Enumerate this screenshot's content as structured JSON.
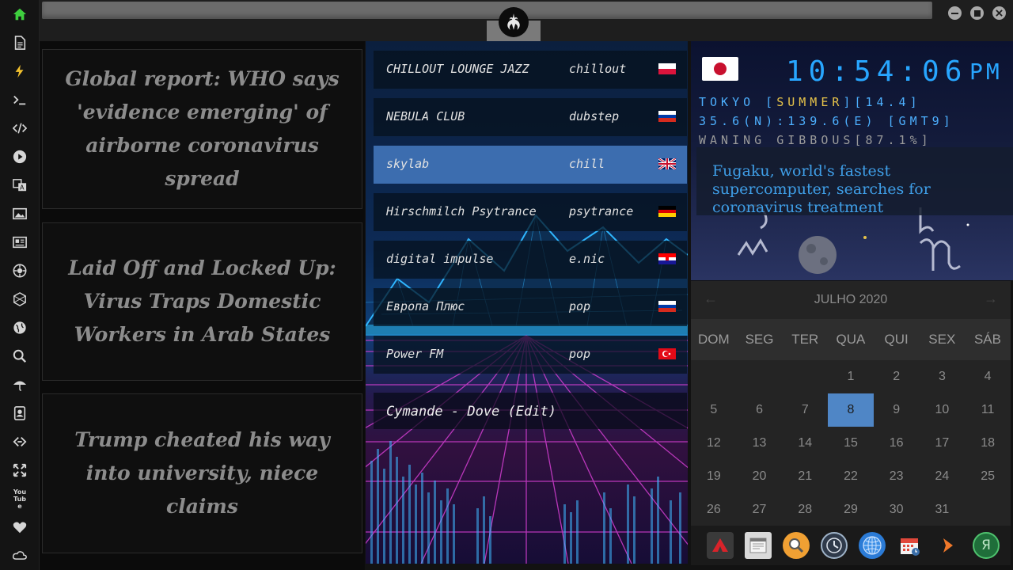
{
  "sidebar": {
    "icons": [
      "home-icon",
      "document-icon",
      "bolt-icon",
      "terminal-icon",
      "code-icon",
      "play-icon",
      "translate-icon",
      "image-icon",
      "news-icon",
      "aperture-icon",
      "hexagon-icon",
      "globe-icon",
      "search-icon",
      "umbrella-icon",
      "contacts-icon",
      "link-icon",
      "expand-icon",
      "youtube-icon",
      "heart-icon",
      "cloud-icon"
    ],
    "youtube_label": "You Tube",
    "accent": "#3ecf3e"
  },
  "news": {
    "articles": [
      {
        "title": "Global report: WHO says 'evidence emerging' of airborne coronavirus spread"
      },
      {
        "title": "Laid Off and Locked Up: Virus Traps Domestic Workers in Arab States"
      },
      {
        "title": "Trump cheated his way into university, niece claims"
      }
    ]
  },
  "radio": {
    "stations": [
      {
        "name": "CHILLOUT LOUNGE JAZZ",
        "genre": "chillout",
        "flag": "pl",
        "selected": false
      },
      {
        "name": "NEBULA CLUB",
        "genre": "dubstep",
        "flag": "ru",
        "selected": false
      },
      {
        "name": "skylab",
        "genre": "chill",
        "flag": "gb",
        "selected": true
      },
      {
        "name": "Hirschmilch Psytrance",
        "genre": "psytrance",
        "flag": "de",
        "selected": false
      },
      {
        "name": "digital impulse",
        "genre": "e.nic",
        "flag": "hr",
        "selected": false
      },
      {
        "name": "Европа Плюс",
        "genre": "pop",
        "flag": "ru",
        "selected": false
      },
      {
        "name": "Power FM",
        "genre": "pop",
        "flag": "tr",
        "selected": false
      }
    ],
    "now_playing": "Cymande - Dove (Edit)"
  },
  "clock": {
    "time": "10:54:06",
    "ampm": "PM",
    "location_prefix": "TOKYO [",
    "season": "SUMMER",
    "location_suffix": "][14.4]",
    "coords": "35.6(N):139.6(E) [GMT9]",
    "moon": "WANING GIBBOUS[87.1%]",
    "headline": "Fugaku, world's fastest supercomputer, searches for coronavirus treatment"
  },
  "calendar": {
    "month_label": "JULHO 2020",
    "prev_label": "←",
    "next_label": "→",
    "weekdays": [
      "DOM",
      "SEG",
      "TER",
      "QUA",
      "QUI",
      "SEX",
      "SÁB"
    ],
    "first_weekday_index": 3,
    "days_in_month": 31,
    "today": 8,
    "today_color": "#4f86c6"
  },
  "dock": {
    "apps": [
      "rebel-app-icon",
      "calendar-widget-icon",
      "search-app-icon",
      "clock-app-icon",
      "globe-app-icon",
      "calendar-app-icon",
      "arrow-app-icon",
      "yandex-icon"
    ],
    "yandex_label": "Я"
  }
}
